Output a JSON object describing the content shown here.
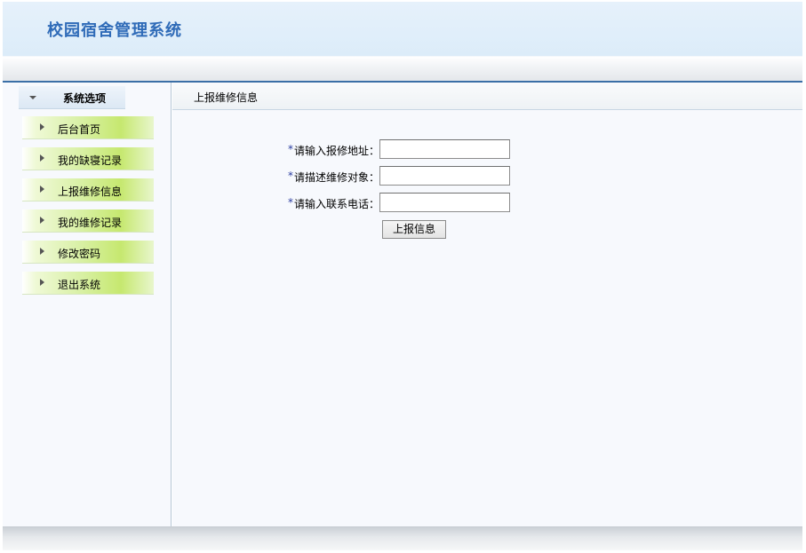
{
  "header": {
    "title": "校园宿舍管理系统"
  },
  "sidebar": {
    "heading": "系统选项",
    "items": [
      {
        "label": "后台首页"
      },
      {
        "label": "我的缺寝记录"
      },
      {
        "label": "上报维修信息"
      },
      {
        "label": "我的维修记录"
      },
      {
        "label": "修改密码"
      },
      {
        "label": "退出系统"
      }
    ]
  },
  "main": {
    "title": "上报维修信息",
    "required_mark": "*",
    "form": {
      "address_label": "请输入报修地址：",
      "address_value": "",
      "object_label": "请描述维修对象：",
      "object_value": "",
      "phone_label": "请输入联系电话：",
      "phone_value": "",
      "submit_label": "上报信息"
    }
  },
  "colors": {
    "title": "#2f6bb8",
    "header_bg": "#e6f1fb",
    "accent_line": "#3b6fa6",
    "menu_green": "#c6e86f",
    "content_bg": "#f7f9fd"
  }
}
